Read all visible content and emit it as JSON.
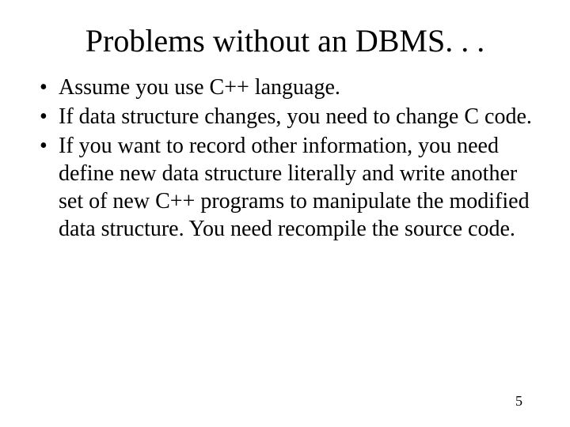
{
  "title": "Problems without an DBMS. . .",
  "bullets": [
    "Assume you use C++ language.",
    "If data structure changes, you need to change C code.",
    "If you want to record other information, you need define new data structure literally and write another set of new C++ programs to manipulate the modified data structure. You need recompile the source code."
  ],
  "page_number": "5"
}
